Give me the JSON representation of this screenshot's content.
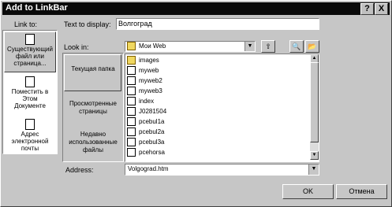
{
  "window": {
    "title": "Add to LinkBar",
    "help_label": "?",
    "close_label": "X"
  },
  "link_to": {
    "label": "Link to:",
    "items": [
      {
        "label": "Существующ­ий файл или страница...",
        "icon": "file-icon"
      },
      {
        "label": "Поместить в Этом Документе",
        "icon": "document-icon"
      },
      {
        "label": "Адрес электронной почты",
        "icon": "email-icon"
      }
    ]
  },
  "text_to_display": {
    "label": "Text to display:",
    "value": "Волгоград"
  },
  "look_in": {
    "label": "Look in:",
    "value": "Мои Web"
  },
  "browse_buttons": [
    {
      "label": "Текущая папка"
    },
    {
      "label": "Просмотренные страницы"
    },
    {
      "label": "Недавно использованные файлы"
    }
  ],
  "files": [
    {
      "name": "images",
      "type": "folder"
    },
    {
      "name": "myweb",
      "type": "file"
    },
    {
      "name": "myweb2",
      "type": "file"
    },
    {
      "name": "myweb3",
      "type": "file"
    },
    {
      "name": "index",
      "type": "file"
    },
    {
      "name": "J0281504",
      "type": "file"
    },
    {
      "name": "pcebul1a",
      "type": "file"
    },
    {
      "name": "pcebul2a",
      "type": "file"
    },
    {
      "name": "pcebul3a",
      "type": "file"
    },
    {
      "name": "pcehorsa",
      "type": "file"
    }
  ],
  "address": {
    "label": "Address:",
    "value": "Volgograd.htm"
  },
  "buttons": {
    "ok": "OK",
    "cancel": "Отмена"
  }
}
